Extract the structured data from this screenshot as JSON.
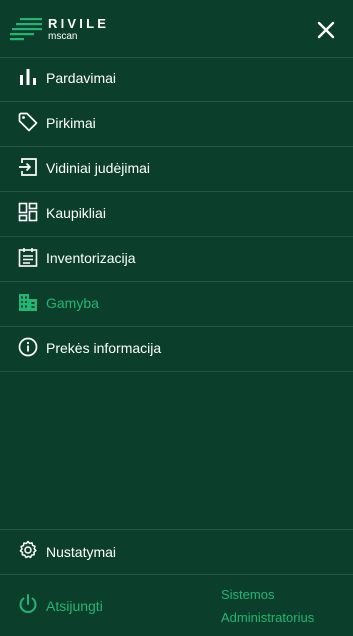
{
  "header": {
    "logo_title": "RIVILE",
    "logo_sub": "mscan",
    "close_icon": "close-icon"
  },
  "menu": [
    {
      "label": "Pardavimai",
      "icon": "bar-chart-icon",
      "active": false
    },
    {
      "label": "Pirkimai",
      "icon": "tag-icon",
      "active": false
    },
    {
      "label": "Vidiniai judėjimai",
      "icon": "login-arrow-icon",
      "active": false
    },
    {
      "label": "Kaupikliai",
      "icon": "dashboard-icon",
      "active": false
    },
    {
      "label": "Inventorizacija",
      "icon": "calendar-list-icon",
      "active": false
    },
    {
      "label": "Gamyba",
      "icon": "factory-icon",
      "active": true
    },
    {
      "label": "Prekės informacija",
      "icon": "info-icon",
      "active": false
    }
  ],
  "footer": {
    "settings_label": "Nustatymai",
    "logout_label": "Atsijungti",
    "user_role": "Sistemos Administratorius"
  },
  "colors": {
    "background": "#0b3f2c",
    "divider": "#24573f",
    "accent": "#22b573",
    "text": "#ffffff"
  }
}
